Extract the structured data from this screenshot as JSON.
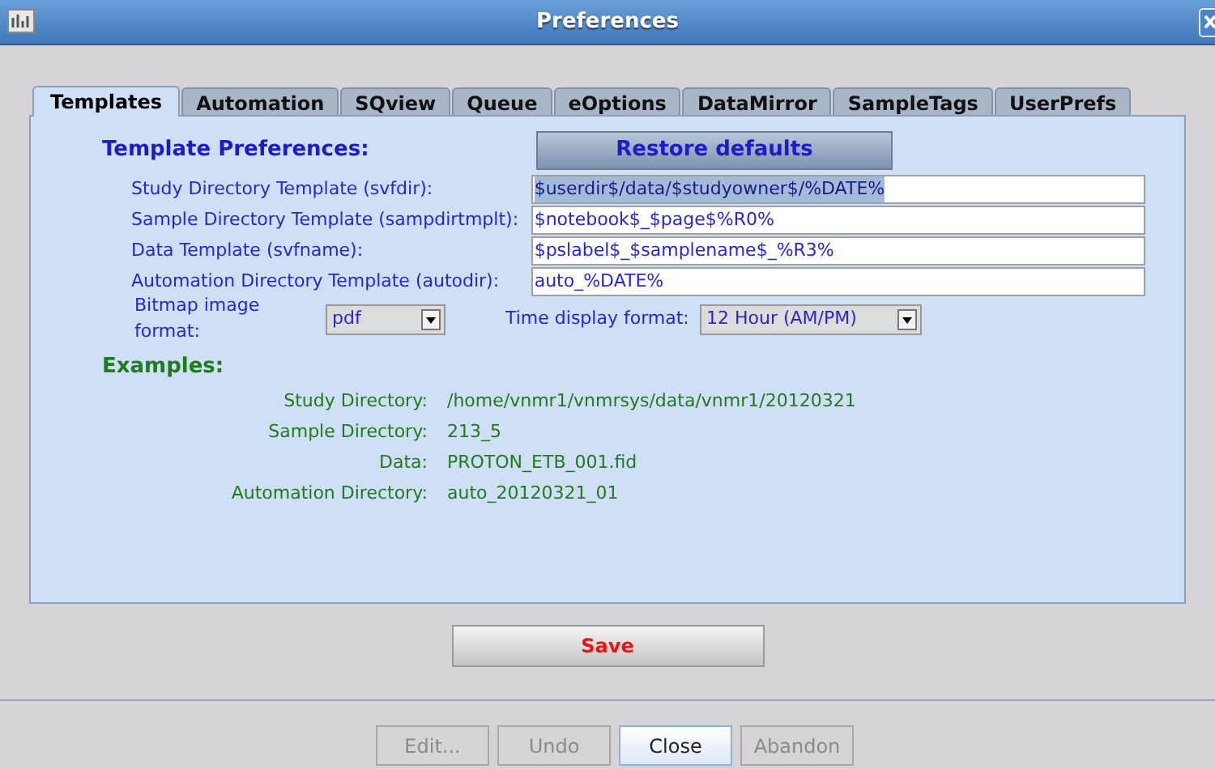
{
  "window": {
    "title": "Preferences"
  },
  "tabs": [
    {
      "label": "Templates",
      "selected": true
    },
    {
      "label": "Automation",
      "selected": false
    },
    {
      "label": "SQview",
      "selected": false
    },
    {
      "label": "Queue",
      "selected": false
    },
    {
      "label": "eOptions",
      "selected": false
    },
    {
      "label": "DataMirror",
      "selected": false
    },
    {
      "label": "SampleTags",
      "selected": false
    },
    {
      "label": "UserPrefs",
      "selected": false
    }
  ],
  "templates": {
    "heading": "Template Preferences:",
    "restore_button": "Restore defaults",
    "fields": [
      {
        "label": "Study Directory Template (svfdir):",
        "value": "$userdir$/data/$studyowner$/%DATE%",
        "selected": true
      },
      {
        "label": "Sample Directory Template (sampdirtmplt):",
        "value": "$notebook$_$page$%R0%",
        "selected": false
      },
      {
        "label": "Data Template (svfname):",
        "value": "$pslabel$_$samplename$_%R3%",
        "selected": false
      },
      {
        "label": "Automation Directory Template (autodir):",
        "value": "auto_%DATE%",
        "selected": false
      }
    ],
    "bitmap_format": {
      "label": "Bitmap image format:",
      "value": "pdf"
    },
    "time_format": {
      "label": "Time display format:",
      "value": "12 Hour (AM/PM)"
    }
  },
  "examples": {
    "heading": "Examples:",
    "rows": [
      {
        "label": "Study Directory:",
        "value": "/home/vnmr1/vnmrsys/data/vnmr1/20120321"
      },
      {
        "label": "Sample Directory:",
        "value": "213_5"
      },
      {
        "label": "Data:",
        "value": "PROTON_ETB_001.fid"
      },
      {
        "label": "Automation Directory:",
        "value": "auto_20120321_01"
      }
    ]
  },
  "save_button": "Save",
  "buttons": [
    {
      "label": "Edit...",
      "disabled": true,
      "focused": false
    },
    {
      "label": "Undo",
      "disabled": true,
      "focused": false
    },
    {
      "label": "Close",
      "disabled": false,
      "focused": true
    },
    {
      "label": "Abandon",
      "disabled": true,
      "focused": false
    }
  ]
}
